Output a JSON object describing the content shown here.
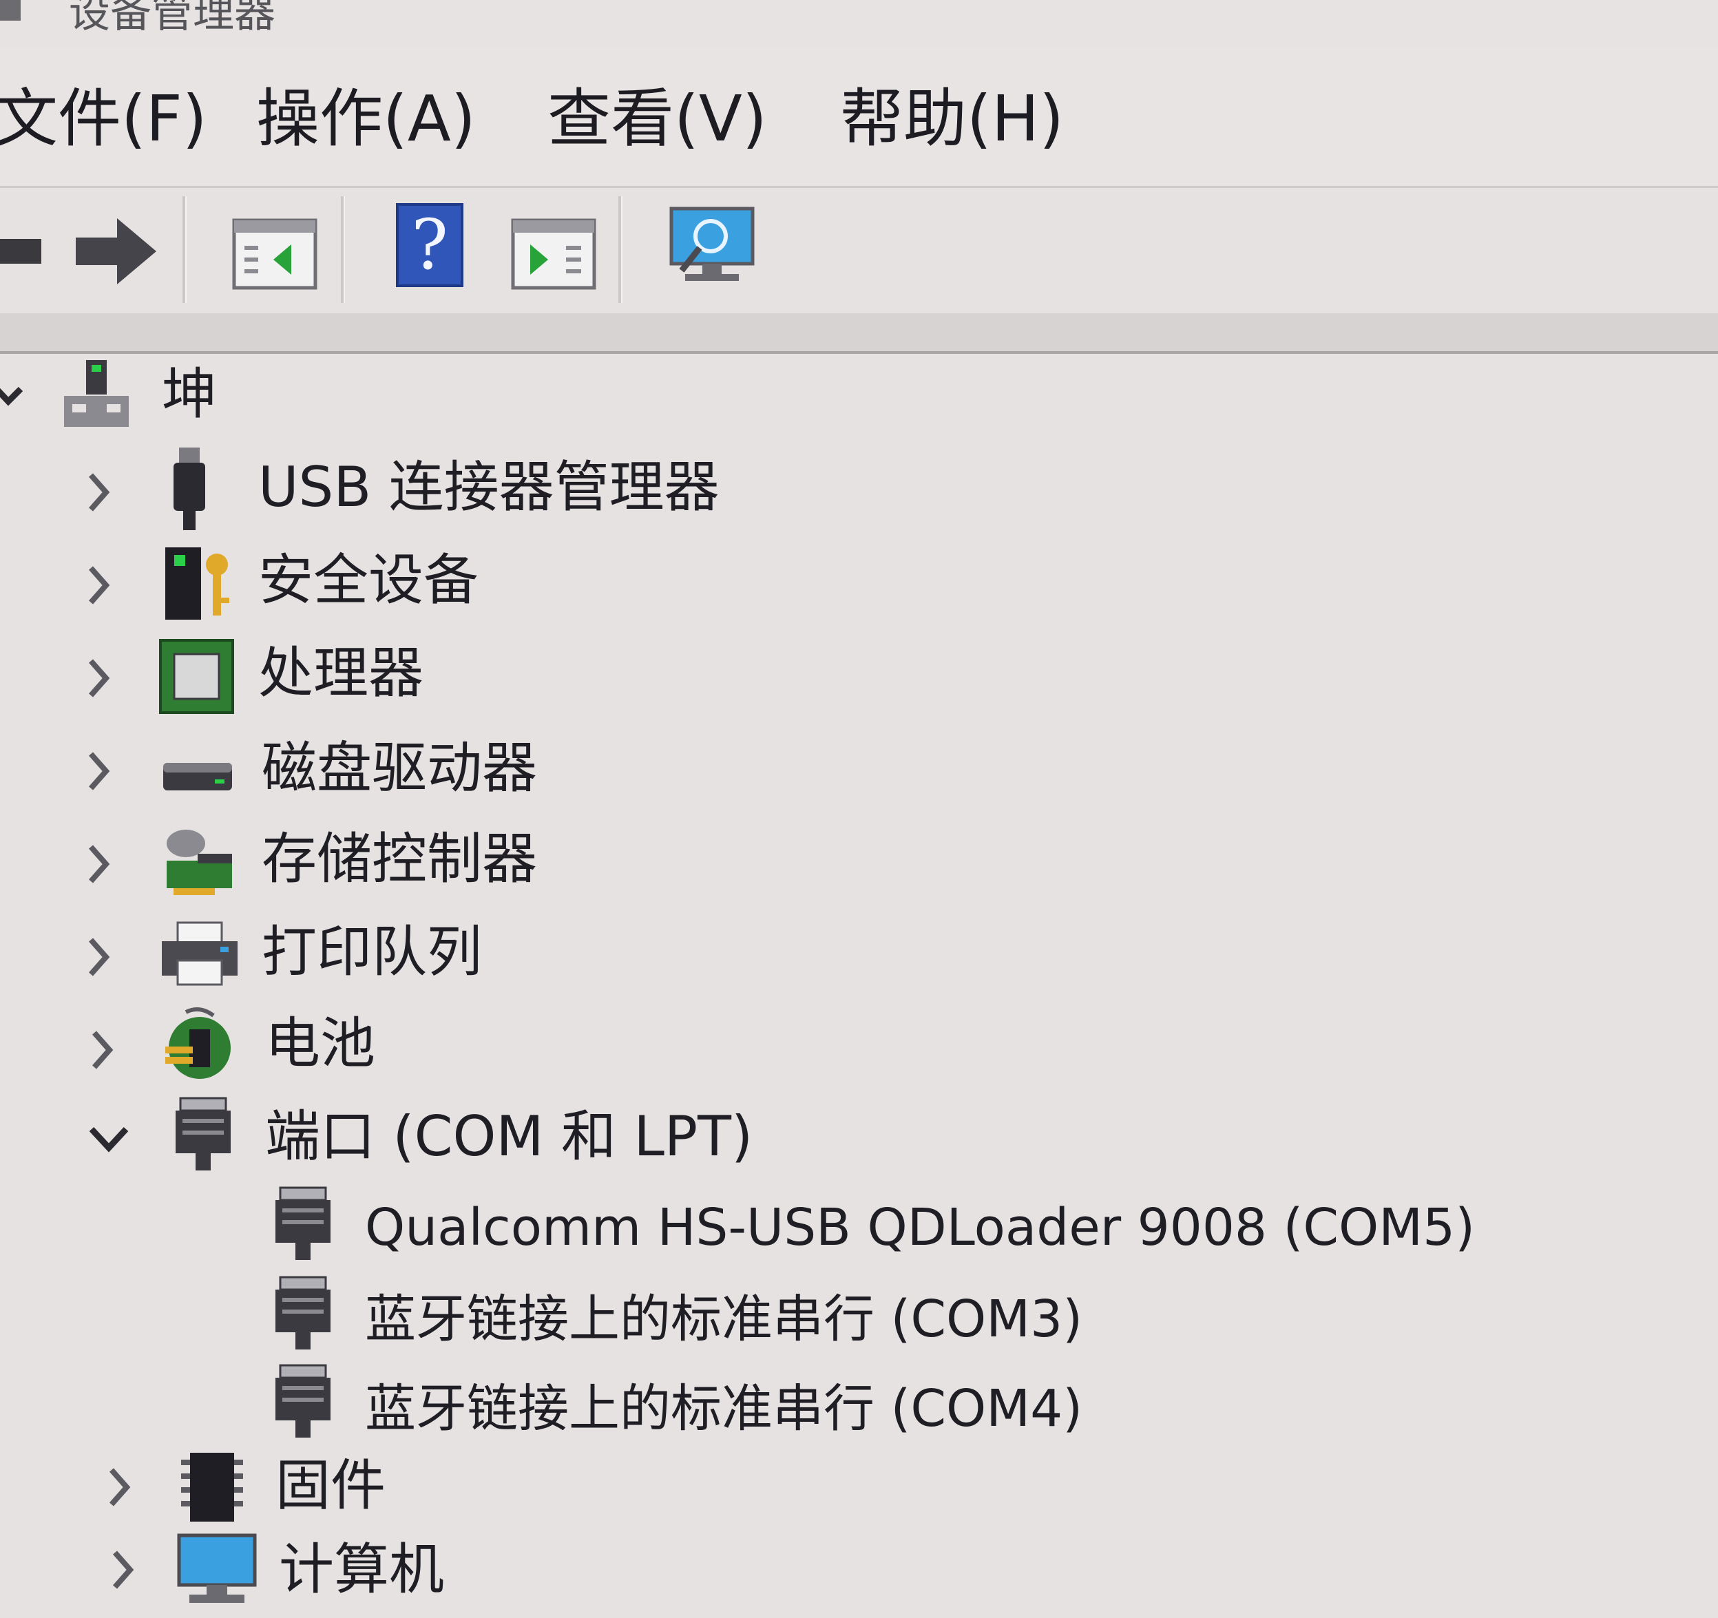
{
  "window": {
    "title": "设备管理器"
  },
  "menu": {
    "file": "文件(F)",
    "action": "操作(A)",
    "view": "查看(V)",
    "help": "帮助(H)"
  },
  "toolbar": {
    "buttons": [
      "back-arrow-icon",
      "forward-arrow-icon",
      "properties-window-icon",
      "help-icon",
      "update-driver-window-icon",
      "scan-hardware-monitor-icon"
    ]
  },
  "tree": {
    "root": {
      "label": "坤",
      "expanded": true
    },
    "nodes": [
      {
        "label": "USB 连接器管理器",
        "expanded": false
      },
      {
        "label": "安全设备",
        "expanded": false
      },
      {
        "label": "处理器",
        "expanded": false
      },
      {
        "label": "磁盘驱动器",
        "expanded": false
      },
      {
        "label": "存储控制器",
        "expanded": false
      },
      {
        "label": "打印队列",
        "expanded": false
      },
      {
        "label": "电池",
        "expanded": false
      },
      {
        "label": "端口 (COM 和 LPT)",
        "expanded": true,
        "children": [
          {
            "label": "Qualcomm HS-USB QDLoader 9008 (COM5)"
          },
          {
            "label": "蓝牙链接上的标准串行 (COM3)"
          },
          {
            "label": "蓝牙链接上的标准串行 (COM4)"
          }
        ]
      },
      {
        "label": "固件",
        "expanded": false
      },
      {
        "label": "计算机",
        "expanded": false
      }
    ]
  },
  "colors": {
    "background": "#e6e2e2",
    "text": "#1e1e24",
    "help_blue": "#2f56b8",
    "monitor_blue": "#3aa0e0",
    "chip_green": "#2e7d32"
  }
}
